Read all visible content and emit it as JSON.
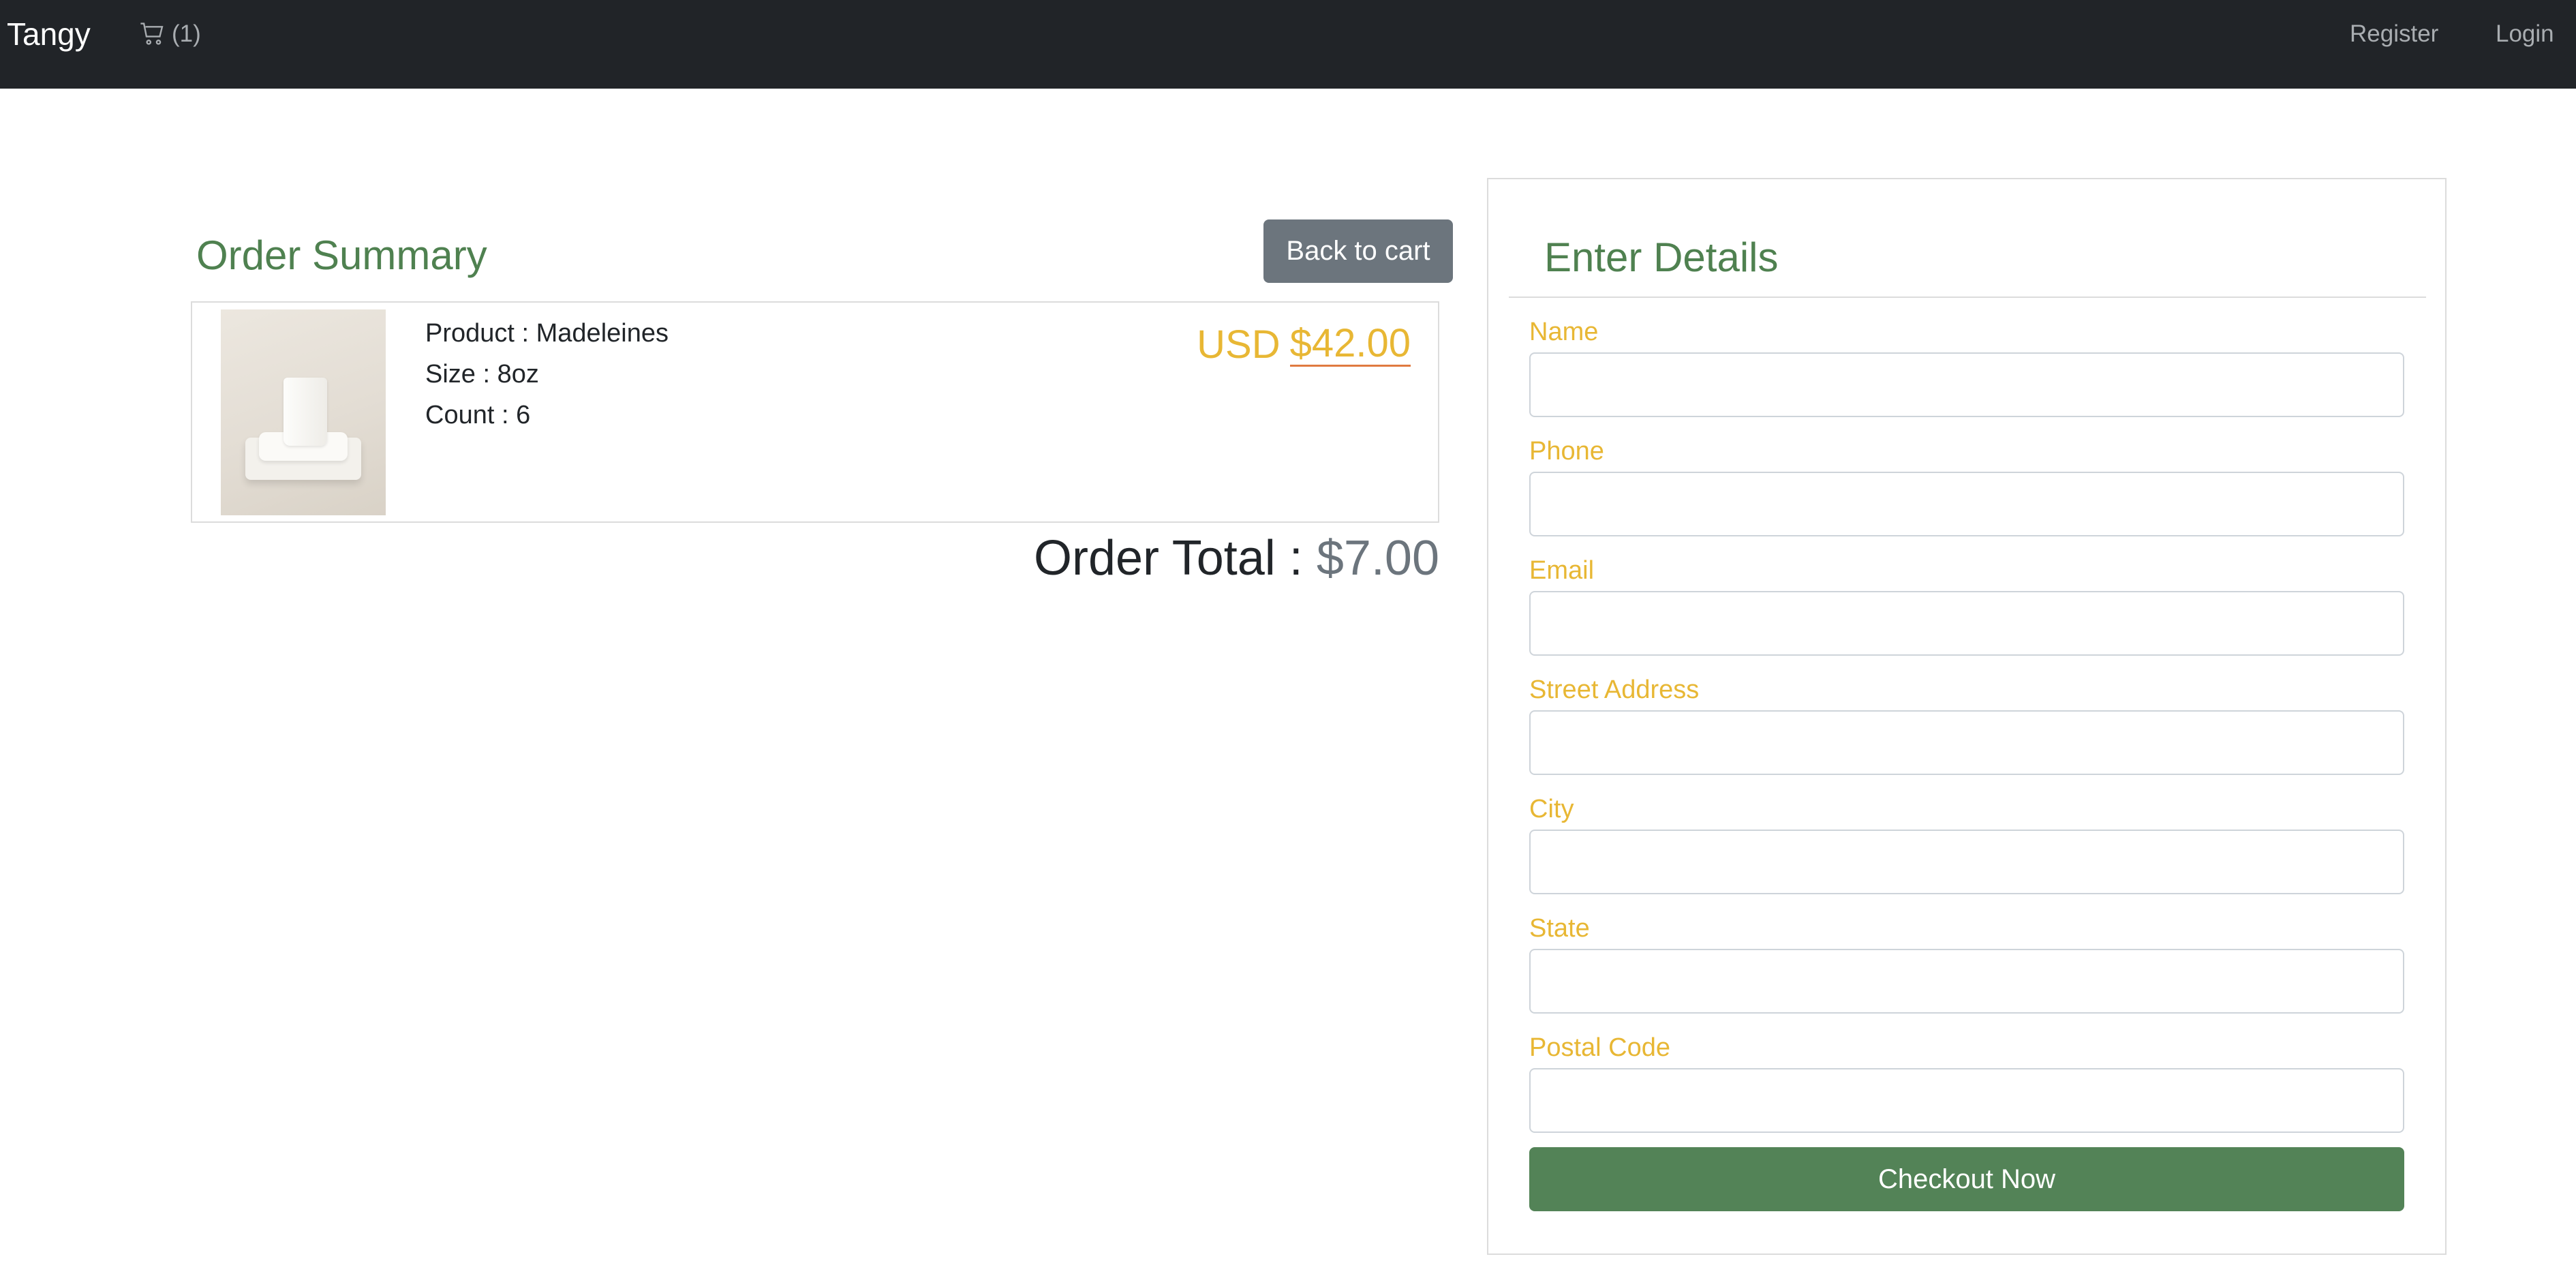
{
  "navbar": {
    "brand": "Tangy",
    "cart_count": "(1)",
    "register": "Register",
    "login": "Login"
  },
  "order_summary": {
    "title": "Order Summary",
    "back_button": "Back to cart",
    "item": {
      "product": "Product : Madeleines",
      "size": "Size : 8oz",
      "count": "Count : 6",
      "currency": "USD",
      "price": "$42.00"
    },
    "total_label": "Order Total : ",
    "total_value": "$7.00"
  },
  "details": {
    "title": "Enter Details",
    "fields": [
      {
        "label": "Name"
      },
      {
        "label": "Phone"
      },
      {
        "label": "Email"
      },
      {
        "label": "Street Address"
      },
      {
        "label": "City"
      },
      {
        "label": "State"
      },
      {
        "label": "Postal Code"
      }
    ],
    "checkout_button": "Checkout Now"
  },
  "colors": {
    "navbar_bg": "#212428",
    "heading_green": "#4f8150",
    "label_gold": "#e8b734",
    "button_gray": "#6c757d",
    "checkout_green": "#538357"
  }
}
